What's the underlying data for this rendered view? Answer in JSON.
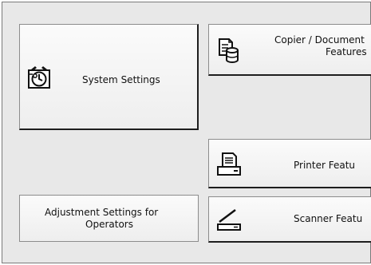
{
  "menu": {
    "system_settings": {
      "label": "System Settings",
      "icon": "alarm-clock-icon"
    },
    "copier_document_server": {
      "label_line1": "Copier / Document",
      "label_line2": "Features",
      "icon": "document-storage-icon"
    },
    "printer_features": {
      "label": "Printer Featu",
      "icon": "printer-icon"
    },
    "scanner_features": {
      "label": "Scanner Featu",
      "icon": "scanner-icon"
    },
    "adjustment_settings_for_operators": {
      "label_line1": "Adjustment Settings for",
      "label_line2": "Operators"
    }
  }
}
